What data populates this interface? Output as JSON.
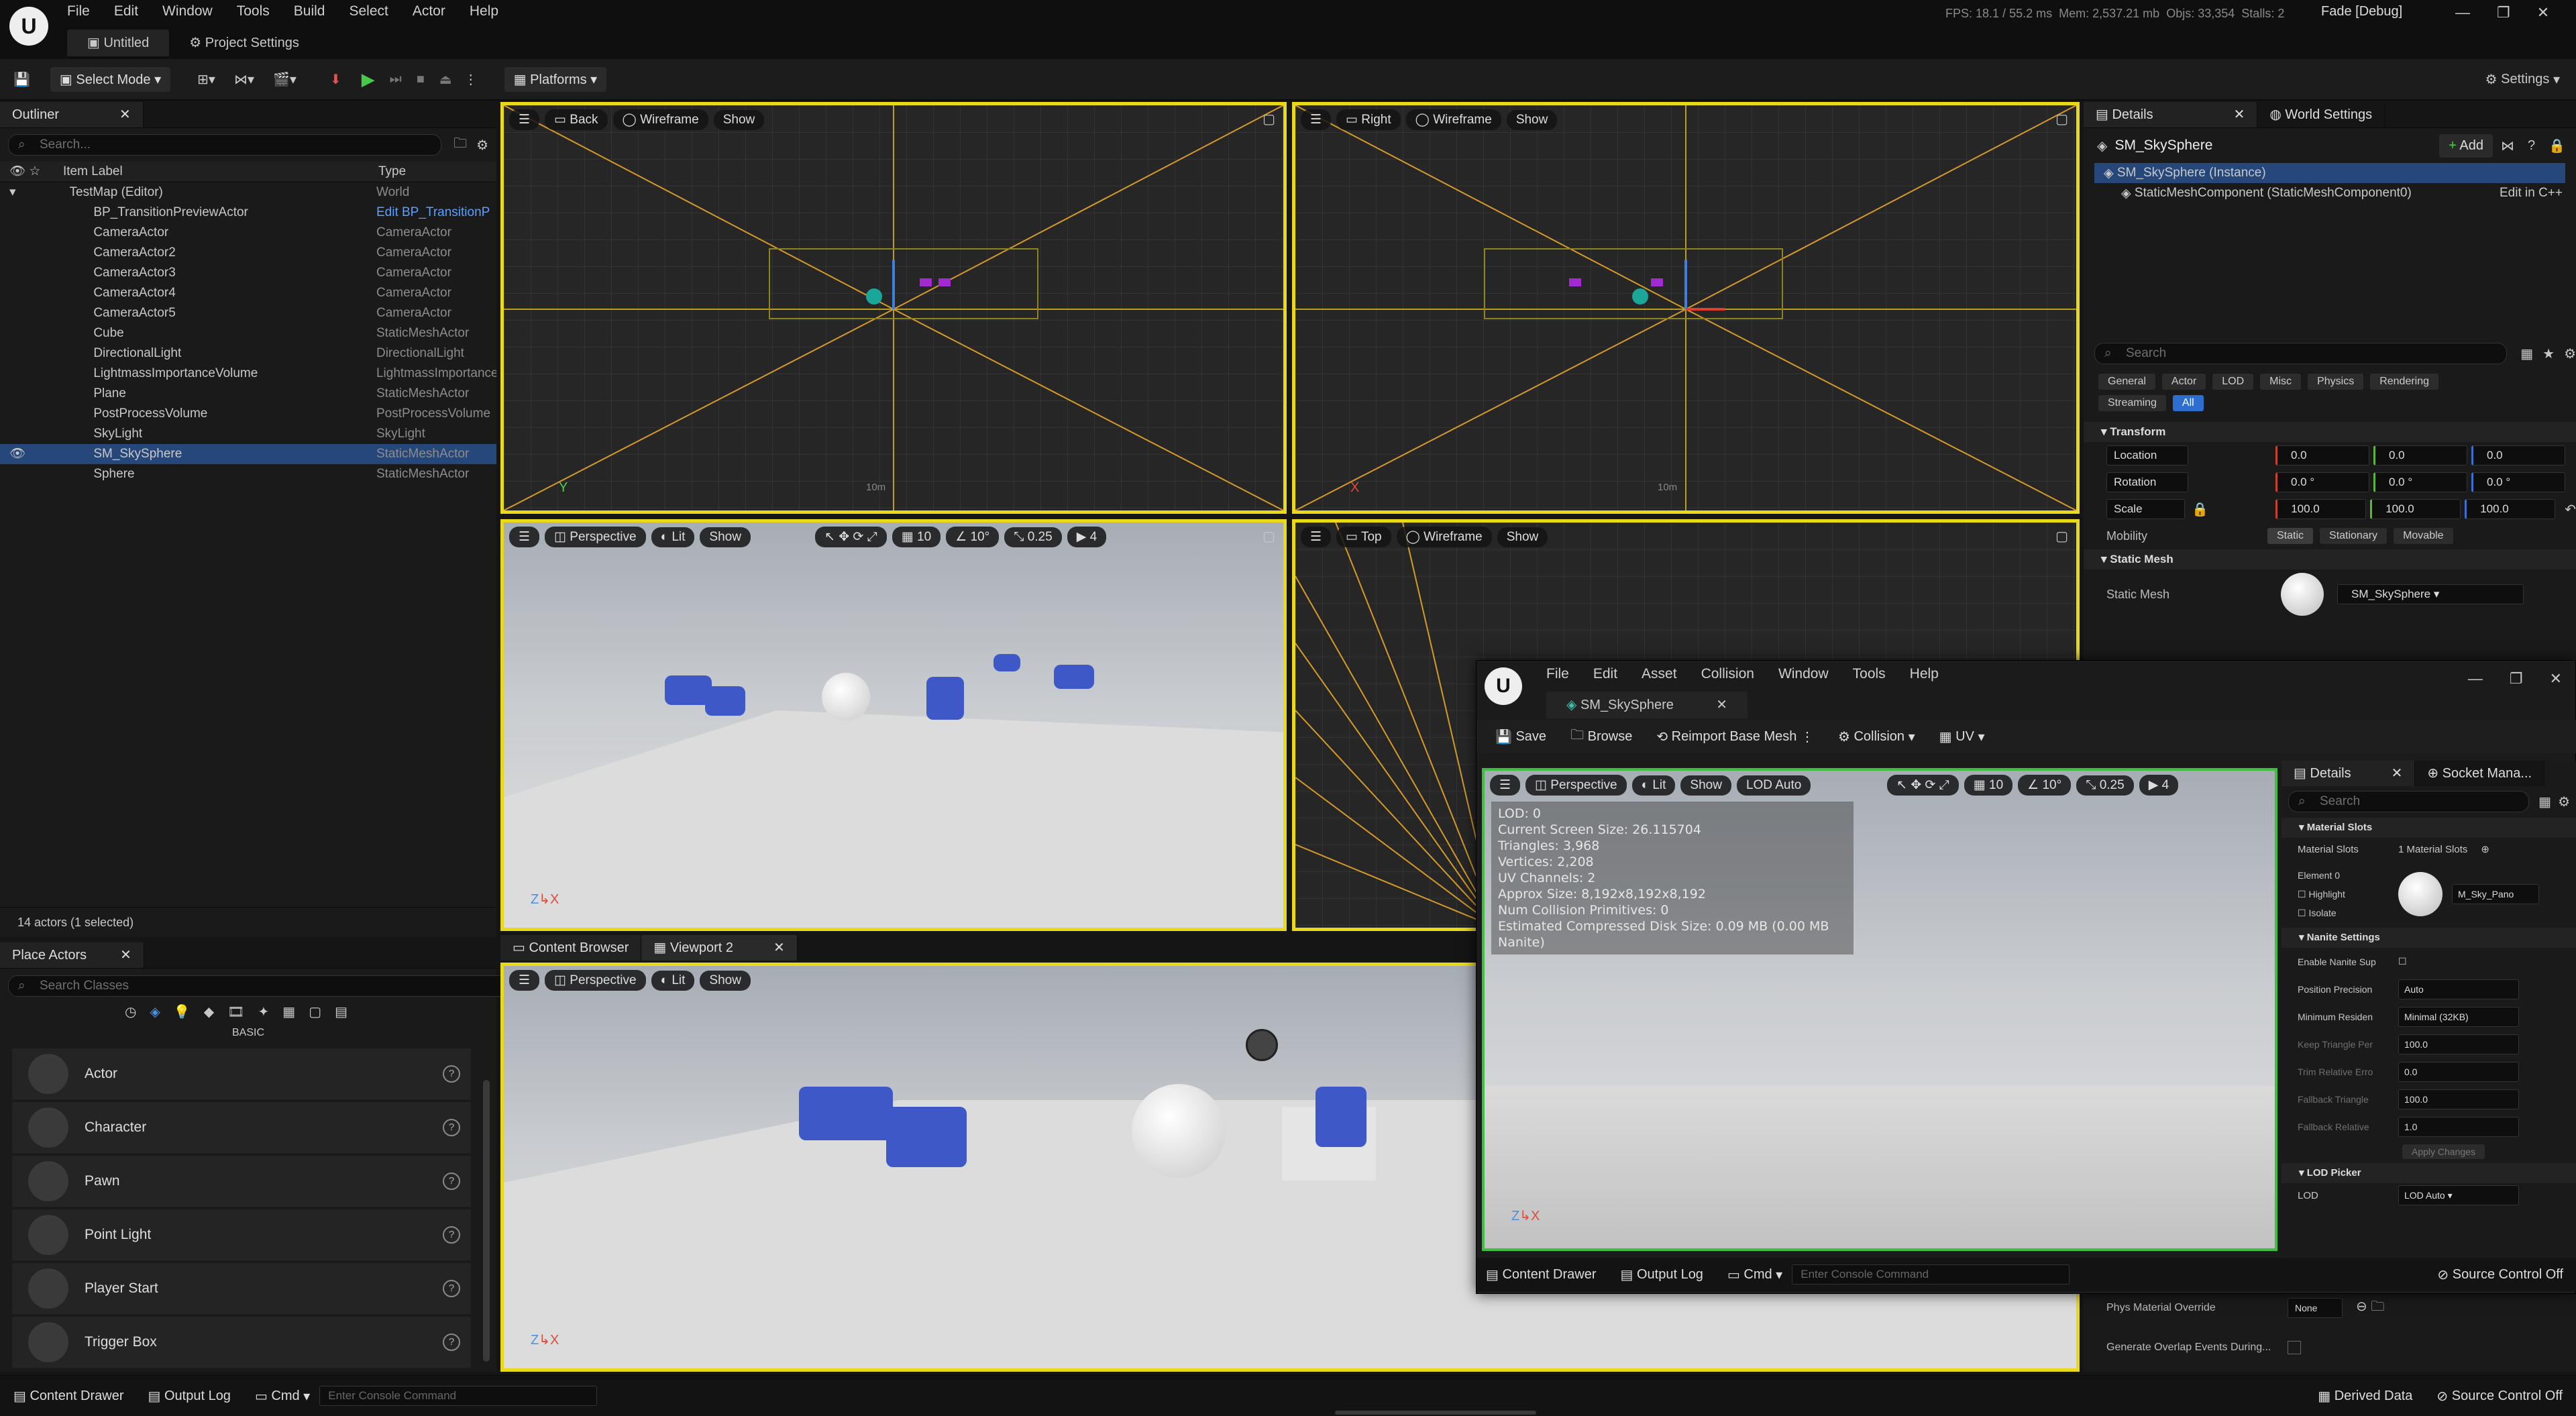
{
  "app": {
    "logo": "unreal-logo",
    "menu": [
      "File",
      "Edit",
      "Window",
      "Tools",
      "Build",
      "Select",
      "Actor",
      "Help"
    ],
    "tabs": [
      "Untitled",
      "Project Settings"
    ],
    "stats": {
      "fps": "FPS: 18.1",
      "ms": "55.2 ms",
      "mem": "Mem: 2,537.21 mb",
      "objs": "Objs: 33,354",
      "stalls": "Stalls: 2"
    },
    "build_config": "Fade [Debug]"
  },
  "toolbar": {
    "mode": "Select Mode",
    "platforms": "Platforms",
    "settings": "Settings"
  },
  "outliner": {
    "title": "Outliner",
    "search_placeholder": "Search...",
    "col_label": "Item Label",
    "col_type": "Type",
    "rows": [
      {
        "label": "TestMap (Editor)",
        "type": "World"
      },
      {
        "label": "BP_TransitionPreviewActor",
        "type": "Edit BP_TransitionP"
      },
      {
        "label": "CameraActor",
        "type": "CameraActor"
      },
      {
        "label": "CameraActor2",
        "type": "CameraActor"
      },
      {
        "label": "CameraActor3",
        "type": "CameraActor"
      },
      {
        "label": "CameraActor4",
        "type": "CameraActor"
      },
      {
        "label": "CameraActor5",
        "type": "CameraActor"
      },
      {
        "label": "Cube",
        "type": "StaticMeshActor"
      },
      {
        "label": "DirectionalLight",
        "type": "DirectionalLight"
      },
      {
        "label": "LightmassImportanceVolume",
        "type": "LightmassImportance"
      },
      {
        "label": "Plane",
        "type": "StaticMeshActor"
      },
      {
        "label": "PostProcessVolume",
        "type": "PostProcessVolume"
      },
      {
        "label": "SkyLight",
        "type": "SkyLight"
      },
      {
        "label": "SM_SkySphere",
        "type": "StaticMeshActor"
      },
      {
        "label": "Sphere",
        "type": "StaticMeshActor"
      }
    ],
    "footer": "14 actors (1 selected)"
  },
  "place_actors": {
    "title": "Place Actors",
    "search_placeholder": "Search Classes",
    "category": "BASIC",
    "items": [
      "Actor",
      "Character",
      "Pawn",
      "Point Light",
      "Player Start",
      "Trigger Box"
    ]
  },
  "viewports": {
    "back": {
      "view": "Back",
      "mode": "Wireframe",
      "show": "Show",
      "scale": "10m",
      "axis1": "Y"
    },
    "right": {
      "view": "Right",
      "mode": "Wireframe",
      "show": "Show",
      "scale": "10m",
      "axis1": "X"
    },
    "persp": {
      "view": "Perspective",
      "mode": "Lit",
      "show": "Show",
      "grid": "10",
      "angle": "10°",
      "scale": "0.25",
      "cam": "4"
    },
    "top": {
      "view": "Top",
      "mode": "Wireframe",
      "show": "Show"
    },
    "vp2": {
      "view": "Perspective",
      "mode": "Lit",
      "show": "Show"
    }
  },
  "lower_tabs": [
    "Content Browser",
    "Viewport 2"
  ],
  "details": {
    "tabs": [
      "Details",
      "World Settings"
    ],
    "actor": "SM_SkySphere",
    "add": "Add",
    "instance": "SM_SkySphere (Instance)",
    "component": "StaticMeshComponent (StaticMeshComponent0)",
    "edit_cpp": "Edit in C++",
    "search_placeholder": "Search",
    "filters": [
      "General",
      "Actor",
      "LOD",
      "Misc",
      "Physics",
      "Rendering",
      "Streaming",
      "All"
    ],
    "transform": "Transform",
    "location": {
      "label": "Location",
      "x": "0.0",
      "y": "0.0",
      "z": "0.0"
    },
    "rotation": {
      "label": "Rotation",
      "x": "0.0 °",
      "y": "0.0 °",
      "z": "0.0 °"
    },
    "scale": {
      "label": "Scale",
      "x": "100.0",
      "y": "100.0",
      "z": "100.0"
    },
    "mobility": {
      "label": "Mobility",
      "options": [
        "Static",
        "Stationary",
        "Movable"
      ]
    },
    "static_mesh_section": "Static Mesh",
    "static_mesh_label": "Static Mesh",
    "static_mesh_value": "SM_SkySphere",
    "phys_override": "Phys Material Override",
    "phys_value": "None",
    "overlap": "Generate Overlap Events During..."
  },
  "mesh_editor": {
    "menu": [
      "File",
      "Edit",
      "Asset",
      "Collision",
      "Window",
      "Tools",
      "Help"
    ],
    "tab": "SM_SkySphere",
    "toolbar": [
      "Save",
      "Browse",
      "Reimport Base Mesh",
      "Collision",
      "UV"
    ],
    "vp": {
      "view": "Perspective",
      "mode": "Lit",
      "show": "Show",
      "lod": "LOD Auto",
      "grid": "10",
      "angle": "10°",
      "scale": "0.25",
      "cam": "4"
    },
    "overlay": [
      "LOD:  0",
      "Current Screen Size:  26.115704",
      "Triangles:  3,968",
      "Vertices:  2,208",
      "UV Channels:  2",
      "Approx Size: 8,192x8,192x8,192",
      "Num Collision Primitives:  0",
      "Estimated Compressed Disk Size: 0.09 MB (0.00 MB Nanite)"
    ],
    "details_tabs": [
      "Details",
      "Socket Mana..."
    ],
    "search_placeholder": "Search",
    "material_slots": "Material Slots",
    "material_slots_label": "Material Slots",
    "material_slots_count": "1 Material Slots",
    "element": "Element 0",
    "highlight": "Highlight",
    "isolate": "Isolate",
    "material_name": "M_Sky_Pano",
    "nanite": "Nanite Settings",
    "nanite_rows": [
      {
        "label": "Enable Nanite Sup",
        "value": ""
      },
      {
        "label": "Position Precision",
        "value": "Auto"
      },
      {
        "label": "Minimum Residen",
        "value": "Minimal (32KB)"
      },
      {
        "label": "Keep Triangle Per",
        "value": "100.0"
      },
      {
        "label": "Trim Relative Erro",
        "value": "0.0"
      },
      {
        "label": "Fallback Triangle",
        "value": "100.0"
      },
      {
        "label": "Fallback Relative",
        "value": "1.0"
      }
    ],
    "apply": "Apply Changes",
    "lod_picker": "LOD Picker",
    "lod_label": "LOD",
    "lod_value": "LOD Auto",
    "bottom": [
      "Content Drawer",
      "Output Log",
      "Cmd"
    ],
    "console_placeholder": "Enter Console Command",
    "source_control": "Source Control Off"
  },
  "statusbar": {
    "content_drawer": "Content Drawer",
    "output_log": "Output Log",
    "cmd": "Cmd",
    "console_placeholder": "Enter Console Command",
    "derived": "Derived Data",
    "source_control": "Source Control Off"
  }
}
